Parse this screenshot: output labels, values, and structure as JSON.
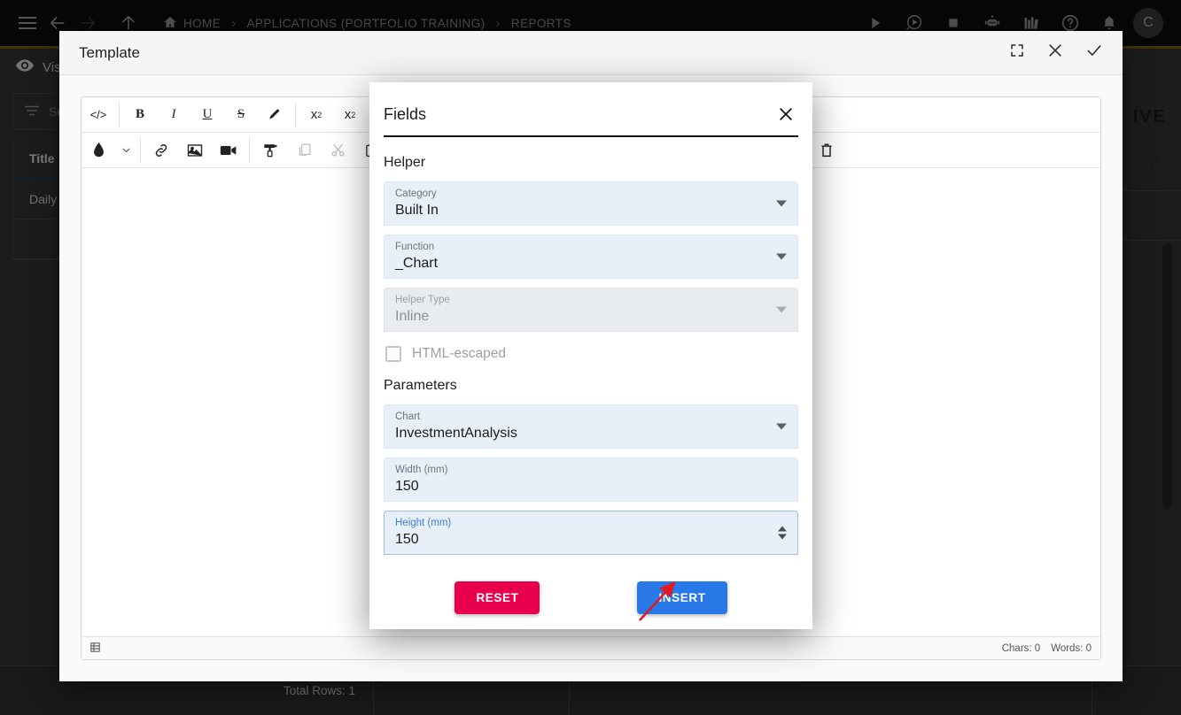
{
  "topbar": {
    "menu_icon": "hamburger-icon",
    "back_icon": "arrow-left-icon",
    "forward_icon": "arrow-right-icon",
    "up_icon": "arrow-up-icon",
    "home_icon": "home-icon",
    "breadcrumbs": [
      {
        "label": "HOME"
      },
      {
        "label": "APPLICATIONS (PORTFOLIO TRAINING)"
      },
      {
        "label": "REPORTS"
      }
    ],
    "separator": "›",
    "right_icons": [
      "play-icon",
      "play-circle-icon",
      "stop-icon",
      "robot-icon",
      "library-icon",
      "help-icon",
      "notification-bell-icon"
    ],
    "avatar_initial": "C"
  },
  "background": {
    "visible_label": "Vis",
    "search_placeholder": "Se",
    "table_header": "Title",
    "table_row": "Daily W",
    "archive_label": "IVE",
    "total_rows": "Total Rows: 1"
  },
  "template_dialog": {
    "title": "Template",
    "fullscreen_icon": "fullscreen-icon",
    "close_icon": "close-icon",
    "confirm_icon": "check-icon",
    "toolbar_row1": [
      "code-icon",
      "bold-icon",
      "italic-icon",
      "underline-icon",
      "strikethrough-icon",
      "highlighter-icon",
      "superscript-icon",
      "subscript-icon"
    ],
    "toolbar_row2": [
      "text-color-icon",
      "chevron-down-icon",
      "link-icon",
      "image-icon",
      "video-icon",
      "format-paint-icon",
      "copy-icon",
      "cut-icon",
      "paste-icon",
      "delete-icon"
    ],
    "status": {
      "grid_icon": "table-icon",
      "chars": "Chars: 0",
      "words": "Words: 0"
    }
  },
  "fields_dialog": {
    "title": "Fields",
    "close_icon": "close-icon",
    "helper_section": "Helper",
    "parameters_section": "Parameters",
    "fields": {
      "category": {
        "label": "Category",
        "value": "Built In"
      },
      "function": {
        "label": "Function",
        "value": "_Chart"
      },
      "helper_type": {
        "label": "Helper Type",
        "value": "Inline"
      },
      "chart": {
        "label": "Chart",
        "value": "InvestmentAnalysis"
      },
      "width": {
        "label": "Width (mm)",
        "value": "150"
      },
      "height": {
        "label": "Height (mm)",
        "value": "150"
      }
    },
    "html_escaped": {
      "label": "HTML-escaped",
      "checked": false
    },
    "buttons": {
      "reset": "RESET",
      "insert": "INSERT"
    }
  },
  "colors": {
    "reset_button": "#e8004f",
    "insert_button": "#2878e8",
    "field_background": "#e7eff8",
    "focus_accent": "#3d7ee0",
    "annotation_arrow": "#e01b24"
  }
}
